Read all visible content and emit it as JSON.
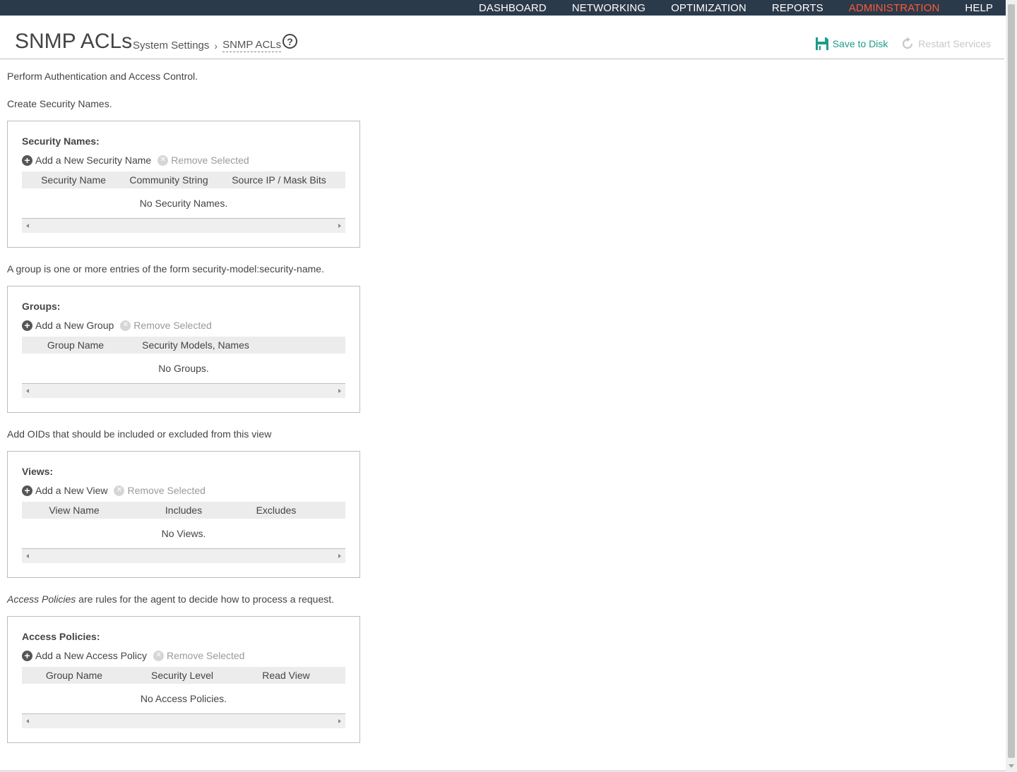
{
  "nav": {
    "items": [
      {
        "label": "DASHBOARD",
        "active": false
      },
      {
        "label": "NETWORKING",
        "active": false
      },
      {
        "label": "OPTIMIZATION",
        "active": false
      },
      {
        "label": "REPORTS",
        "active": false
      },
      {
        "label": "ADMINISTRATION",
        "active": true
      },
      {
        "label": "HELP",
        "active": false
      }
    ],
    "background_color": "#2b3a4b",
    "active_color": "#ff5a36"
  },
  "header": {
    "title": "SNMP ACLs",
    "breadcrumb": {
      "parent": "System Settings",
      "separator": "›",
      "current": "SNMP ACLs"
    },
    "help_icon": "question-circle-icon",
    "help_glyph": "?",
    "save_label": "Save to Disk",
    "save_icon": "floppy-disk-icon",
    "save_color": "#1e9b8a",
    "restart_label": "Restart Services",
    "restart_icon": "refresh-icon"
  },
  "intro": {
    "line1": "Perform Authentication and Access Control.",
    "line2": "Create Security Names."
  },
  "security_names": {
    "title": "Security Names:",
    "add_label": "Add a New Security Name",
    "remove_label": "Remove Selected",
    "columns": [
      "Security Name",
      "Community String",
      "Source IP / Mask Bits"
    ],
    "empty": "No Security Names."
  },
  "groups_desc": "A group is one or more entries of the form security-model:security-name.",
  "groups": {
    "title": "Groups:",
    "add_label": "Add a New Group",
    "remove_label": "Remove Selected",
    "columns": [
      "Group Name",
      "Security Models, Names"
    ],
    "empty": "No Groups."
  },
  "views_desc": "Add OIDs that should be included or excluded from this view",
  "views": {
    "title": "Views:",
    "add_label": "Add a New View",
    "remove_label": "Remove Selected",
    "columns": [
      "View Name",
      "Includes",
      "Excludes"
    ],
    "empty": "No Views."
  },
  "policies_desc": {
    "emphasis": "Access Policies",
    "rest": " are rules for the agent to decide how to process a request."
  },
  "access_policies": {
    "title": "Access Policies:",
    "add_label": "Add a New Access Policy",
    "remove_label": "Remove Selected",
    "columns": [
      "Group Name",
      "Security Level",
      "Read View"
    ],
    "empty": "No Access Policies."
  },
  "icons": {
    "add": "plus-circle-icon",
    "add_glyph": "+",
    "remove": "x-circle-icon",
    "remove_glyph": "✕"
  }
}
